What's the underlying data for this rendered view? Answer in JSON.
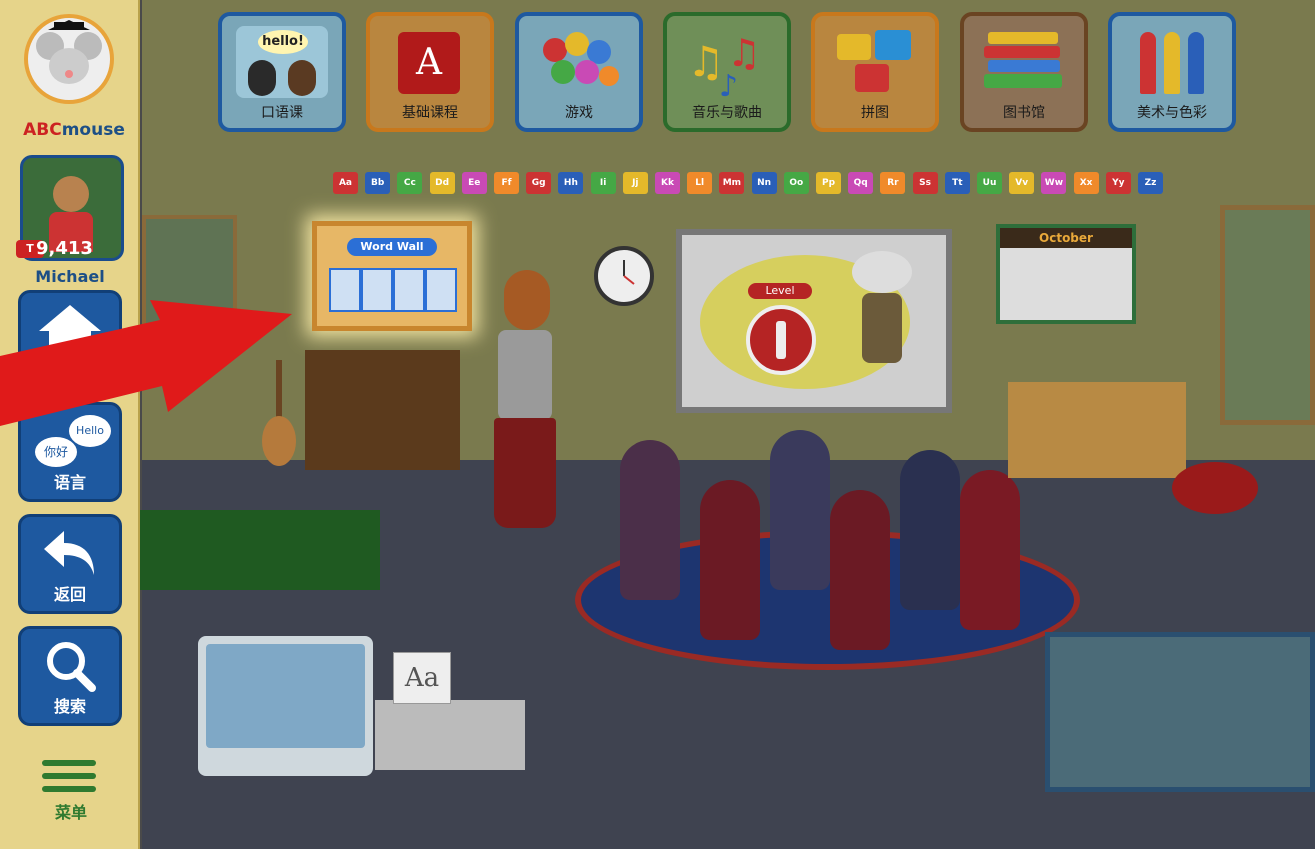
{
  "app": {
    "logo_text_prefix": "ABC",
    "logo_text_suffix": "mouse"
  },
  "user": {
    "name": "Michael",
    "points": "9,413",
    "badge": "T"
  },
  "sidebar": {
    "items": [
      {
        "label": "",
        "icon": "home-icon"
      },
      {
        "label": "语言",
        "icon": "language-bubbles-icon",
        "bubble_left": "你好",
        "bubble_right": "Hello"
      },
      {
        "label": "返回",
        "icon": "back-arrow-icon"
      },
      {
        "label": "搜索",
        "icon": "search-icon"
      }
    ],
    "menu_label": "菜单"
  },
  "topnav": {
    "items": [
      {
        "label": "口语课",
        "icon": "hello-speech-icon",
        "art_text": "hello!"
      },
      {
        "label": "基础课程",
        "icon": "alphabet-block-icon",
        "art_text": "A"
      },
      {
        "label": "游戏",
        "icon": "balls-icon"
      },
      {
        "label": "音乐与歌曲",
        "icon": "music-notes-icon"
      },
      {
        "label": "拼图",
        "icon": "puzzle-icon"
      },
      {
        "label": "图书馆",
        "icon": "books-icon"
      },
      {
        "label": "美术与色彩",
        "icon": "crayons-icon"
      }
    ]
  },
  "classroom": {
    "alphabet_train": [
      "Aa",
      "Bb",
      "Cc",
      "Dd",
      "Ee",
      "Ff",
      "Gg",
      "Hh",
      "Ii",
      "Jj",
      "Kk",
      "Ll",
      "Mm",
      "Nn",
      "Oo",
      "Pp",
      "Qq",
      "Rr",
      "Ss",
      "Tt",
      "Uu",
      "Vv",
      "Ww",
      "Xx",
      "Yy",
      "Zz"
    ],
    "word_wall_title": "Word Wall",
    "board_level_label": "Level",
    "calendar_month": "October",
    "printer_sheet_text": "Aa"
  },
  "colors": {
    "nav_blue": "#1e59a0",
    "menu_green": "#2f7a2f",
    "highlight_arrow": "#e01a1a"
  }
}
